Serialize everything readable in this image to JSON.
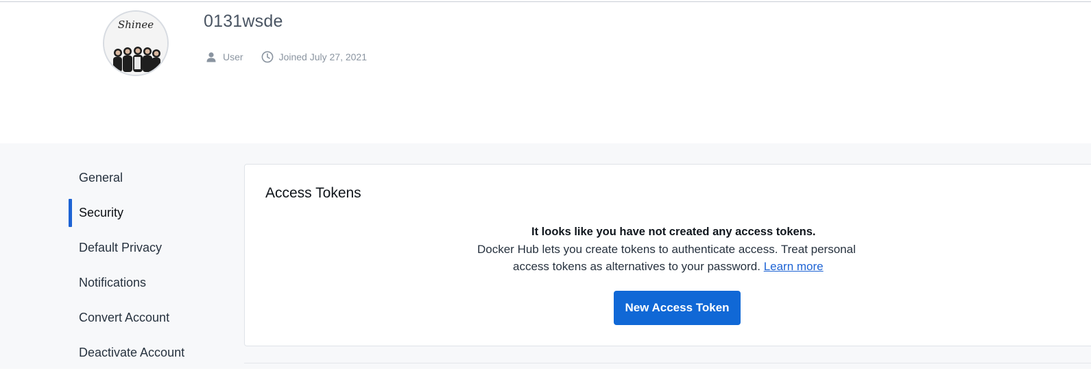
{
  "profile": {
    "username": "0131wsde",
    "avatar_icon": "profile-avatar-image",
    "avatar_text": "Shinee",
    "meta": {
      "role": "User",
      "role_icon": "user-icon",
      "joined": "Joined July 27, 2021",
      "joined_icon": "clock-icon"
    }
  },
  "sidebar": {
    "items": [
      {
        "label": "General",
        "active": false
      },
      {
        "label": "Security",
        "active": true
      },
      {
        "label": "Default Privacy",
        "active": false
      },
      {
        "label": "Notifications",
        "active": false
      },
      {
        "label": "Convert Account",
        "active": false
      },
      {
        "label": "Deactivate Account",
        "active": false
      }
    ]
  },
  "panel": {
    "title": "Access Tokens",
    "empty": {
      "headline": "It looks like you have not created any access tokens.",
      "line1": "Docker Hub lets you create tokens to authenticate access. Treat personal",
      "line2": "access tokens as alternatives to your password.",
      "learn_more": "Learn more"
    },
    "new_token_button": "New Access Token"
  },
  "colors": {
    "accent": "#1d63d4",
    "button": "#1068d6",
    "page_bg": "#f7f8fa",
    "panel_bg": "#ffffff",
    "meta_text": "#8a94a0"
  }
}
